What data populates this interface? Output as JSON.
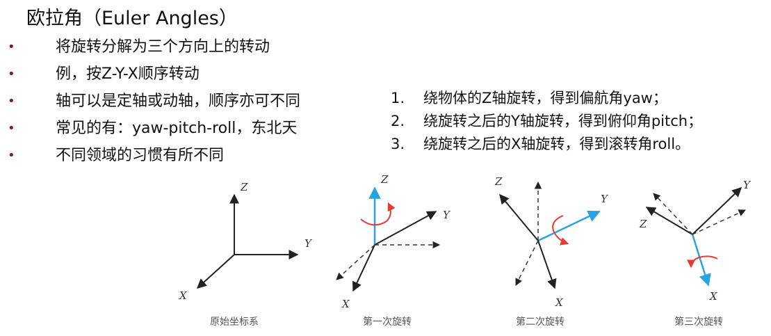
{
  "title": "欧拉角（Euler Angles）",
  "bullets": [
    "将旋转分解为三个方向上的转动",
    "例，按Z-Y-X顺序转动",
    "轴可以是定轴或动轴，顺序亦可不同",
    "常见的有：yaw-pitch-roll，东北天",
    "不同领域的习惯有所不同"
  ],
  "bullet_symbol": "•",
  "steps": [
    {
      "num": "1.",
      "text": "绕物体的Z轴旋转，得到偏航角yaw；"
    },
    {
      "num": "2.",
      "text": "绕旋转之后的Y轴旋转，得到俯仰角pitch；"
    },
    {
      "num": "3.",
      "text": "绕旋转之后的X轴旋转，得到滚转角roll。"
    }
  ],
  "diagrams": [
    {
      "caption": "原始坐标系",
      "labels": {
        "z": "Z",
        "y": "Y",
        "x": "X"
      }
    },
    {
      "caption": "第一次旋转",
      "labels": {
        "z": "Z",
        "y": "Y",
        "x": "X"
      }
    },
    {
      "caption": "第二次旋转",
      "labels": {
        "z": "Z",
        "y": "Y",
        "x": "X"
      }
    },
    {
      "caption": "第三次旋转",
      "labels": {
        "z": "Z",
        "y": "Y",
        "x": "X"
      }
    }
  ],
  "colors": {
    "axis": "#222222",
    "highlight_axis": "#29a3df",
    "rotation_arrow": "#e53935",
    "bullet": "#7a1e1e"
  }
}
